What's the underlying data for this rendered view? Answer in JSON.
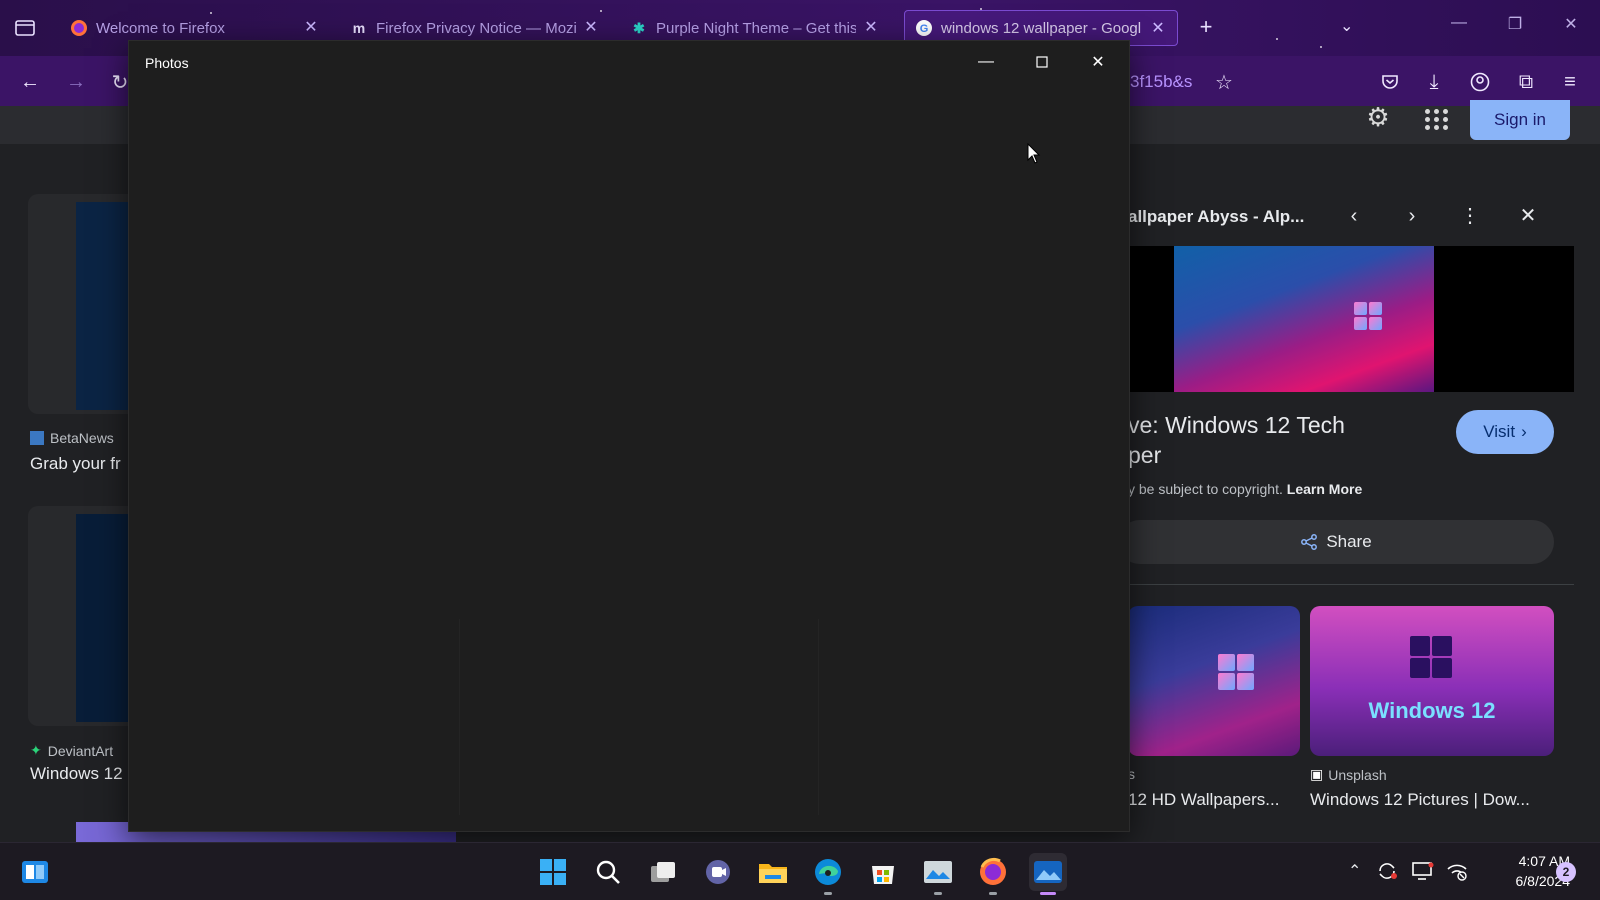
{
  "browser": {
    "tabs": [
      {
        "title": "Welcome to Firefox",
        "favicon": "firefox-icon"
      },
      {
        "title": "Firefox Privacy Notice — Mozil",
        "favicon": "mozilla-m-icon"
      },
      {
        "title": "Purple Night Theme – Get this",
        "favicon": "puzzle-piece-icon"
      },
      {
        "title": "windows 12 wallpaper - Googl",
        "favicon": "google-icon"
      }
    ],
    "url_fragment": "3f15b&s"
  },
  "google": {
    "sign_in": "Sign in",
    "results": [
      {
        "source": "BetaNews",
        "caption": "Grab your fr"
      },
      {
        "source": "DeviantArt",
        "caption": "Windows 12"
      }
    ],
    "side_panel": {
      "title": "allpaper Abyss - Alp...",
      "heading_line1": "ve: Windows 12 Tech",
      "heading_line2": "per",
      "visit": "Visit",
      "copyright": "y be subject to copyright.",
      "learn_more": "Learn More",
      "share": "Share",
      "related": [
        {
          "source": "s",
          "caption": "12 HD Wallpapers..."
        },
        {
          "source": "Unsplash",
          "caption": "Windows 12 Pictures | Dow...",
          "overlay": "Windows 12"
        }
      ]
    }
  },
  "photos_window": {
    "title": "Photos"
  },
  "taskbar": {
    "time": "4:07 AM",
    "date": "6/8/2024",
    "notification_count": "2"
  }
}
